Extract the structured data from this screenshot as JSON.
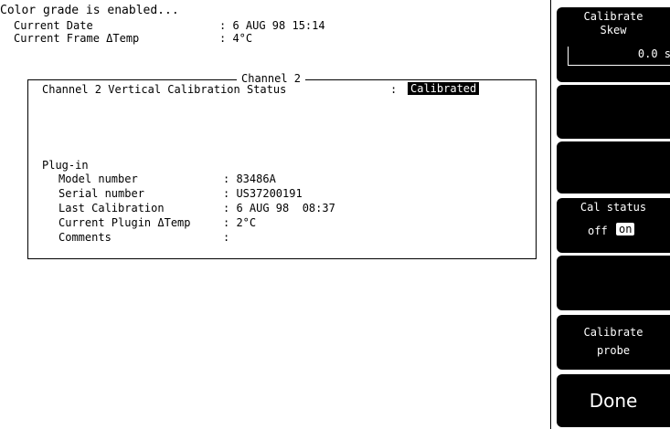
{
  "header": {
    "line1": "Color grade is enabled...",
    "current_date_label": "Current Date",
    "current_date_value": ": 6 AUG 98 15:14",
    "frame_temp_label": "Current Frame ΔTemp",
    "frame_temp_value": ": 4°C"
  },
  "channel_panel": {
    "title": "Channel 2",
    "status_label": "Channel 2 Vertical Calibration Status",
    "status_sep": ":",
    "status_value": "Calibrated",
    "plugin_heading": "Plug-in",
    "rows": [
      {
        "label": "Model number",
        "value": ": 83486A"
      },
      {
        "label": "Serial number",
        "value": ": US37200191"
      },
      {
        "label": "Last Calibration",
        "value": ": 6 AUG 98  08:37"
      },
      {
        "label": "Current Plugin ΔTemp",
        "value": ": 2°C"
      },
      {
        "label": "Comments",
        "value": ":"
      }
    ]
  },
  "softkeys": {
    "calibrate_skew": {
      "line1": "Calibrate",
      "line2": "Skew",
      "value": "0.0 s"
    },
    "cal_status": {
      "label": "Cal status",
      "off": "off",
      "on": "on"
    },
    "calibrate_probe": {
      "line1": "Calibrate",
      "line2": "probe"
    },
    "done": "Done"
  }
}
